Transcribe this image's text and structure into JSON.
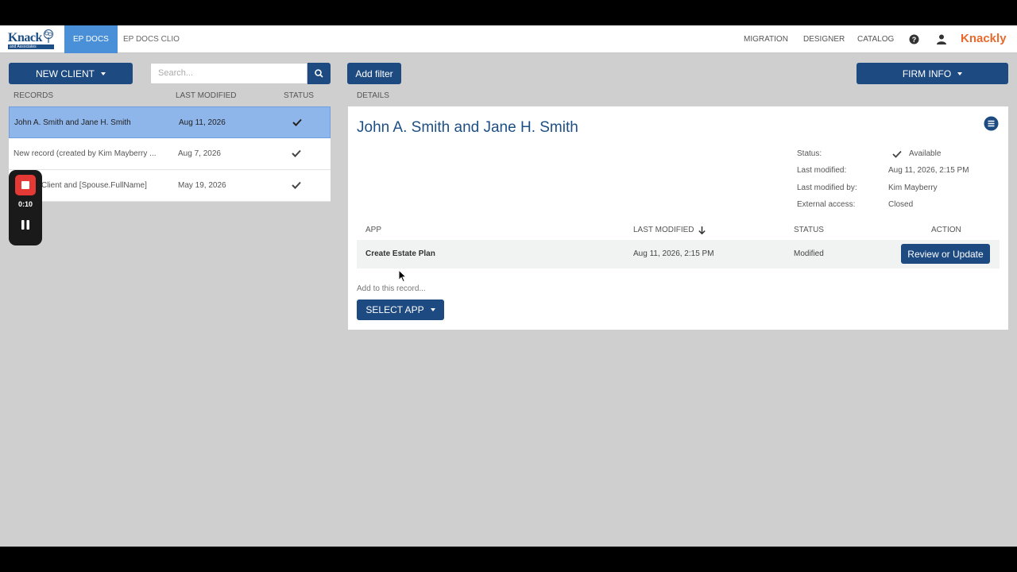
{
  "nav": {
    "logo_text": "Knack",
    "logo_sub": "and Associates",
    "tabs": [
      {
        "label": "EP DOCS",
        "active": true
      },
      {
        "label": "EP DOCS CLIO",
        "active": false
      }
    ],
    "right_links": [
      "MIGRATION",
      "DESIGNER",
      "CATALOG"
    ],
    "brand": "Knackly"
  },
  "toolbar": {
    "new_client": "NEW CLIENT",
    "search_placeholder": "Search...",
    "add_filter": "Add filter",
    "firm_info": "FIRM INFO"
  },
  "records": {
    "headers": {
      "name": "RECORDS",
      "modified": "LAST MODIFIED",
      "status": "STATUS"
    },
    "rows": [
      {
        "name": "John A. Smith and Jane H. Smith",
        "modified": "Aug 11, 2026",
        "status": "check",
        "selected": true
      },
      {
        "name": "New record (created by Kim Mayberry ...",
        "modified": "Aug 7, 2026",
        "status": "check",
        "selected": false
      },
      {
        "name": "Client and [Spouse.FullName]",
        "modified": "May 19, 2026",
        "status": "check",
        "selected": false
      }
    ]
  },
  "recorder": {
    "time": "0:10",
    "stop_color": "#e53935"
  },
  "details": {
    "header": "DETAILS",
    "title": "John A. Smith and Jane H. Smith",
    "meta": [
      {
        "label": "Status:",
        "value": "Available"
      },
      {
        "label": "Last modified:",
        "value": "Aug 11, 2026, 2:15 PM"
      },
      {
        "label": "Last modified by:",
        "value": "Kim Mayberry"
      },
      {
        "label": "External access:",
        "value": "Closed"
      }
    ],
    "apps_headers": {
      "app": "APP",
      "modified": "LAST MODIFIED",
      "status": "STATUS",
      "action": "ACTION"
    },
    "apps": [
      {
        "app": "Create Estate Plan",
        "modified": "Aug 11, 2026, 2:15 PM",
        "status": "Modified",
        "action": "Review or Update"
      }
    ],
    "add_to_record": "Add to this record...",
    "select_app": "SELECT APP"
  },
  "colors": {
    "primary": "#1d4a80",
    "accent": "#4a90d9",
    "brand": "#e8692c",
    "selected_row": "#8fb6ea"
  }
}
